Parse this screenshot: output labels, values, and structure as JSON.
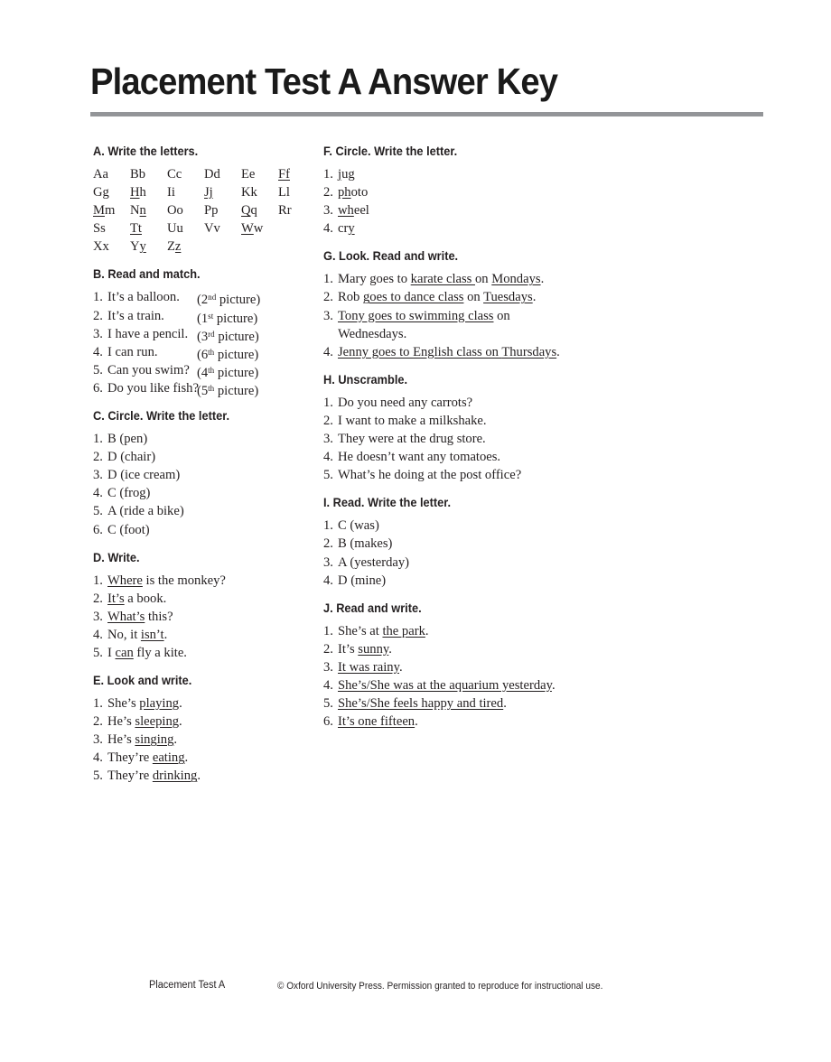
{
  "document": {
    "title": "Placement Test A Answer Key"
  },
  "footer": {
    "test_name": "Placement Test A",
    "copyright": "© Oxford University Press. Permission granted to reproduce for instructional use."
  },
  "colors": {
    "rule": "#939598",
    "text": "#231f20"
  },
  "sections": {
    "a": {
      "heading": "A. Write the letters.",
      "letters": [
        {
          "plain": "Aa",
          "pre": "Aa",
          "under": "",
          "post": ""
        },
        {
          "plain": "Bb",
          "pre": "Bb",
          "under": "",
          "post": ""
        },
        {
          "plain": "Cc",
          "pre": "Cc",
          "under": "",
          "post": ""
        },
        {
          "plain": "Dd",
          "pre": "Dd",
          "under": "",
          "post": ""
        },
        {
          "plain": "Ee",
          "pre": "Ee",
          "under": "",
          "post": ""
        },
        {
          "plain": "Ff",
          "pre": "",
          "under": "Ff",
          "post": ""
        },
        {
          "plain": "Gg",
          "pre": "Gg",
          "under": "",
          "post": ""
        },
        {
          "plain": "Hh",
          "pre": "",
          "under": "H",
          "post": "h"
        },
        {
          "plain": "Ii",
          "pre": "Ii",
          "under": "",
          "post": ""
        },
        {
          "plain": "Jj",
          "pre": "",
          "under": "Jj",
          "post": ""
        },
        {
          "plain": "Kk",
          "pre": "Kk",
          "under": "",
          "post": ""
        },
        {
          "plain": "Ll",
          "pre": "Ll",
          "under": "",
          "post": ""
        },
        {
          "plain": "Mm",
          "pre": "",
          "under": "M",
          "post": "m"
        },
        {
          "plain": "Nn",
          "pre": "N",
          "under": "n",
          "post": ""
        },
        {
          "plain": "Oo",
          "pre": "Oo",
          "under": "",
          "post": ""
        },
        {
          "plain": "Pp",
          "pre": "Pp",
          "under": "",
          "post": ""
        },
        {
          "plain": "Qq",
          "pre": "",
          "under": "Q",
          "post": "q"
        },
        {
          "plain": "Rr",
          "pre": "Rr",
          "under": "",
          "post": ""
        },
        {
          "plain": "Ss",
          "pre": "Ss",
          "under": "",
          "post": ""
        },
        {
          "plain": "Tt",
          "pre": "",
          "under": "Tt",
          "post": ""
        },
        {
          "plain": "Uu",
          "pre": "Uu",
          "under": "",
          "post": ""
        },
        {
          "plain": "Vv",
          "pre": "Vv",
          "under": "",
          "post": ""
        },
        {
          "plain": "Ww",
          "pre": "",
          "under": "W",
          "post": "w"
        },
        {
          "plain": "",
          "pre": "",
          "under": "",
          "post": ""
        },
        {
          "plain": "Xx",
          "pre": "Xx",
          "under": "",
          "post": ""
        },
        {
          "plain": "Yy",
          "pre": "Y",
          "under": "y",
          "post": ""
        },
        {
          "plain": "Zz",
          "pre": "Z",
          "under": "z",
          "post": ""
        }
      ]
    },
    "b": {
      "heading": "B. Read and match.",
      "items": [
        {
          "num": "1.",
          "text": "It’s a balloon.",
          "ordinal": "2",
          "sup": "nd",
          "picture": " picture)"
        },
        {
          "num": "2.",
          "text": "It’s a train.",
          "ordinal": "1",
          "sup": "st",
          "picture": " picture)"
        },
        {
          "num": "3.",
          "text": "I have a pencil.",
          "ordinal": "3",
          "sup": "rd",
          "picture": " picture)"
        },
        {
          "num": "4.",
          "text": "I can run.",
          "ordinal": "6",
          "sup": "th",
          "picture": " picture)"
        },
        {
          "num": "5.",
          "text": "Can you swim?",
          "ordinal": "4",
          "sup": "th",
          "picture": " picture)"
        },
        {
          "num": "6.",
          "text": "Do you like fish?",
          "ordinal": "5",
          "sup": "th",
          "picture": " picture)"
        }
      ]
    },
    "c": {
      "heading": "C. Circle. Write the letter.",
      "items": [
        {
          "num": "1.",
          "text": "B (pen)"
        },
        {
          "num": "2.",
          "text": "D (chair)"
        },
        {
          "num": "3.",
          "text": "D (ice cream)"
        },
        {
          "num": "4.",
          "text": "C (frog)"
        },
        {
          "num": "5.",
          "text": "A (ride a bike)"
        },
        {
          "num": "6.",
          "text": "C (foot)"
        }
      ]
    },
    "d": {
      "heading": "D. Write.",
      "items": [
        {
          "num": "1.",
          "pre": "",
          "under": "Where",
          "post": " is the monkey?"
        },
        {
          "num": "2.",
          "pre": "",
          "under": "It’s",
          "post": " a book."
        },
        {
          "num": "3.",
          "pre": "",
          "under": "What’s",
          "post": " this?"
        },
        {
          "num": "4.",
          "pre": "No, it ",
          "under": "isn’t",
          "post": "."
        },
        {
          "num": "5.",
          "pre": "I ",
          "under": "can",
          "post": " fly a kite."
        }
      ]
    },
    "e": {
      "heading": "E. Look and write.",
      "items": [
        {
          "num": "1.",
          "pre": "She’s ",
          "under": "playing",
          "post": "."
        },
        {
          "num": "2.",
          "pre": "He’s ",
          "under": "sleeping",
          "post": "."
        },
        {
          "num": "3.",
          "pre": "He’s ",
          "under": "singing",
          "post": "."
        },
        {
          "num": "4.",
          "pre": "They’re ",
          "under": "eating",
          "post": "."
        },
        {
          "num": "5.",
          "pre": "They’re ",
          "under": "drinking",
          "post": "."
        }
      ]
    },
    "f": {
      "heading": "F. Circle. Write the letter.",
      "items": [
        {
          "num": "1.",
          "pre": "",
          "under": "j",
          "post": "ug"
        },
        {
          "num": "2.",
          "pre": "",
          "under": "ph",
          "post": "oto"
        },
        {
          "num": "3.",
          "pre": "",
          "under": "wh",
          "post": "eel"
        },
        {
          "num": "4.",
          "pre": "cr",
          "under": "y",
          "post": ""
        }
      ]
    },
    "g": {
      "heading": "G. Look. Read and write.",
      "items": [
        {
          "num": "1.",
          "parts": [
            {
              "t": "Mary goes to ",
              "u": false
            },
            {
              "t": "karate class ",
              "u": true
            },
            {
              "t": "on ",
              "u": false
            },
            {
              "t": "Mondays",
              "u": true
            },
            {
              "t": ".",
              "u": false
            }
          ]
        },
        {
          "num": "2.",
          "parts": [
            {
              "t": "Rob ",
              "u": false
            },
            {
              "t": "goes to dance class",
              "u": true
            },
            {
              "t": " on ",
              "u": false
            },
            {
              "t": "Tuesdays",
              "u": true
            },
            {
              "t": ".",
              "u": false
            }
          ]
        },
        {
          "num": "3.",
          "parts": [
            {
              "t": "Tony goes to swimming class",
              "u": true
            },
            {
              "t": " on Wednesdays.",
              "u": false
            }
          ]
        },
        {
          "num": "4.",
          "parts": [
            {
              "t": "Jenny goes to English class on ",
              "u": true
            },
            {
              "t": "Thursdays",
              "u": true
            },
            {
              "t": ".",
              "u": false
            }
          ]
        }
      ]
    },
    "h": {
      "heading": "H. Unscramble.",
      "items": [
        {
          "num": "1.",
          "text": "Do you need any carrots?"
        },
        {
          "num": "2.",
          "text": "I want to make a milkshake."
        },
        {
          "num": "3.",
          "text": "They were at the drug store."
        },
        {
          "num": "4.",
          "text": "He doesn’t want any tomatoes."
        },
        {
          "num": "5.",
          "text": "What’s he doing at the post office?"
        }
      ]
    },
    "i": {
      "heading": "I. Read. Write the letter.",
      "items": [
        {
          "num": "1.",
          "text": "C (was)"
        },
        {
          "num": "2.",
          "text": "B (makes)"
        },
        {
          "num": "3.",
          "text": "A (yesterday)"
        },
        {
          "num": "4.",
          "text": "D (mine)"
        }
      ]
    },
    "j": {
      "heading": "J. Read and write.",
      "items": [
        {
          "num": "1.",
          "pre": "She’s at ",
          "under": "the park",
          "post": "."
        },
        {
          "num": "2.",
          "pre": "It’s ",
          "under": "sunny",
          "post": "."
        },
        {
          "num": "3.",
          "pre": "",
          "under": "It was rainy",
          "post": "."
        },
        {
          "num": "4.",
          "pre": "",
          "under": "She’s/She was at the aquarium yesterday",
          "post": "."
        },
        {
          "num": "5.",
          "pre": "",
          "under": "She’s/She feels happy and tired",
          "post": "."
        },
        {
          "num": "6.",
          "pre": "",
          "under": "It’s one fifteen",
          "post": "."
        }
      ]
    }
  }
}
